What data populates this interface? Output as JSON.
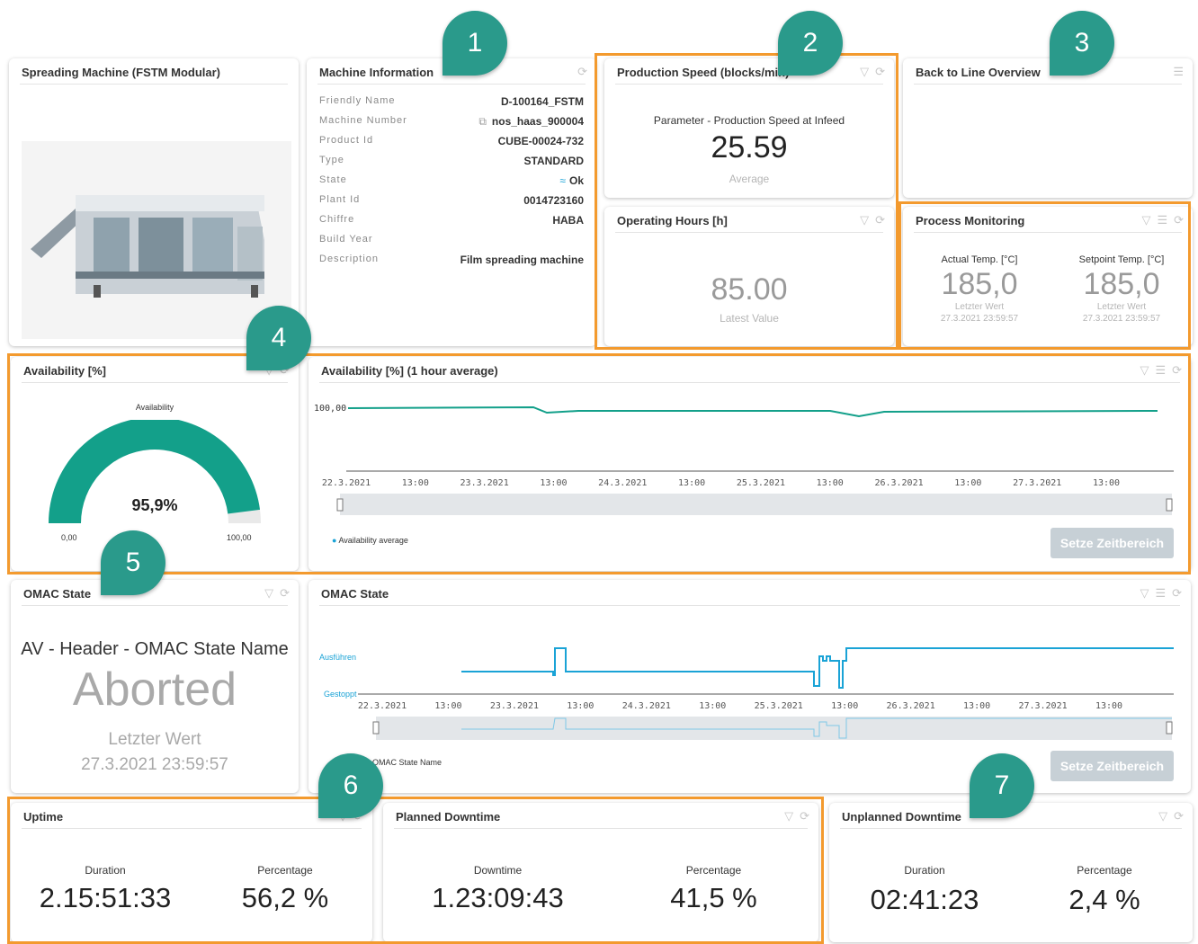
{
  "markers": [
    "1",
    "2",
    "3",
    "4",
    "5",
    "6",
    "7"
  ],
  "colors": {
    "accent_teal": "#13a08a",
    "accent_blue": "#1aa3d6",
    "highlight": "#f39a2e",
    "marker": "#2a9a8b"
  },
  "spreading": {
    "title": "Spreading Machine (FSTM Modular)"
  },
  "machine_info": {
    "title": "Machine Information",
    "rows": [
      {
        "key": "Friendly Name",
        "value": "D-100164_FSTM"
      },
      {
        "key": "Machine Number",
        "value": "nos_haas_900004"
      },
      {
        "key": "Product Id",
        "value": "CUBE-00024-732"
      },
      {
        "key": "Type",
        "value": "STANDARD"
      },
      {
        "key": "State",
        "value": "Ok"
      },
      {
        "key": "Plant Id",
        "value": "0014723160"
      },
      {
        "key": "Chiffre",
        "value": "HABA"
      },
      {
        "key": "Build Year",
        "value": ""
      },
      {
        "key": "Description",
        "value": "Film spreading machine"
      }
    ]
  },
  "production_speed": {
    "title": "Production Speed (blocks/min)",
    "subtitle": "Parameter - Production Speed at Infeed",
    "value": "25.59",
    "caption": "Average"
  },
  "back_to_line": {
    "title": "Back to Line Overview"
  },
  "operating_hours": {
    "title": "Operating Hours [h]",
    "value": "85.00",
    "caption": "Latest Value"
  },
  "process_monitoring": {
    "title": "Process Monitoring",
    "actual": {
      "label": "Actual Temp. [°C]",
      "value": "185,0",
      "caption": "Letzter Wert",
      "timestamp": "27.3.2021 23:59:57"
    },
    "setpoint": {
      "label": "Setpoint Temp. [°C]",
      "value": "185,0",
      "caption": "Letzter Wert",
      "timestamp": "27.3.2021 23:59:57"
    }
  },
  "availability_gauge": {
    "title": "Availability [%]",
    "label": "Availability",
    "value": "95,9%",
    "fraction": 0.959,
    "min": "0,00",
    "max": "100,00"
  },
  "availability_chart": {
    "title": "Availability [%] (1 hour average)",
    "y_label": "100,00",
    "x_ticks": [
      "22.3.2021",
      "13:00",
      "23.3.2021",
      "13:00",
      "24.3.2021",
      "13:00",
      "25.3.2021",
      "13:00",
      "26.3.2021",
      "13:00",
      "27.3.2021",
      "13:00"
    ],
    "legend": "Availability average",
    "button": "Setze Zeitbereich"
  },
  "omac_state": {
    "title": "OMAC State",
    "label": "AV - Header - OMAC State Name",
    "value": "Aborted",
    "caption": "Letzter Wert",
    "timestamp": "27.3.2021 23:59:57"
  },
  "omac_chart": {
    "title": "OMAC State",
    "y_labels": [
      "Ausführen",
      "Gestoppt"
    ],
    "x_ticks": [
      "22.3.2021",
      "13:00",
      "23.3.2021",
      "13:00",
      "24.3.2021",
      "13:00",
      "25.3.2021",
      "13:00",
      "26.3.2021",
      "13:00",
      "27.3.2021",
      "13:00"
    ],
    "legend": "der - OMAC State Name",
    "button": "Setze Zeitbereich"
  },
  "uptime": {
    "title": "Uptime",
    "duration_label": "Duration",
    "duration": "2.15:51:33",
    "percentage_label": "Percentage",
    "percentage": "56,2 %"
  },
  "planned_downtime": {
    "title": "Planned Downtime",
    "duration_label": "Downtime",
    "duration": "1.23:09:43",
    "percentage_label": "Percentage",
    "percentage": "41,5 %"
  },
  "unplanned_downtime": {
    "title": "Unplanned Downtime",
    "duration_label": "Duration",
    "duration": "02:41:23",
    "percentage_label": "Percentage",
    "percentage": "2,4 %"
  }
}
